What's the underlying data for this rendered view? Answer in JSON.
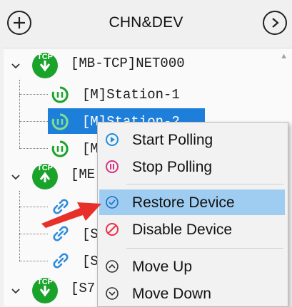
{
  "header": {
    "title": "CHN&DEV",
    "add_icon": "plus-circle-icon",
    "next_icon": "chevron-right-circle-icon"
  },
  "tree": {
    "nodes": [
      {
        "label": "[MB-TCP]NET000",
        "icon": "tcp-connection-icon"
      },
      {
        "label": "[M]Station-1",
        "icon": "polling-device-icon"
      },
      {
        "label": "[M]Station-2",
        "icon": "polling-device-icon",
        "selected": true
      },
      {
        "label": "[M",
        "icon": "polling-device-icon"
      },
      {
        "label": "[ME",
        "icon": "tcp-connection-icon"
      },
      {
        "label": "",
        "icon": "link-device-icon"
      },
      {
        "label": "[S",
        "icon": "link-device-icon"
      },
      {
        "label": "[S",
        "icon": "link-device-icon"
      },
      {
        "label": "[S7",
        "icon": "tcp-connection-icon"
      }
    ]
  },
  "context_menu": {
    "items": [
      {
        "label": "Start Polling",
        "icon": "play-circle-icon"
      },
      {
        "label": "Stop Polling",
        "icon": "pause-circle-icon"
      },
      {
        "label": "Restore Device",
        "icon": "check-circle-icon",
        "highlighted": true
      },
      {
        "label": "Disable Device",
        "icon": "disable-icon"
      },
      {
        "label": "Move Up",
        "icon": "up-circle-icon"
      },
      {
        "label": "Move Down",
        "icon": "down-circle-icon"
      }
    ]
  },
  "colors": {
    "tcp_green": "#1aa32a",
    "selection_blue": "#1e7fdb",
    "menu_highlight": "#9fcdf2",
    "start_polling_blue": "#1f8fe0",
    "stop_polling_pink": "#d63384",
    "disable_red": "#e8344a",
    "link_blue": "#2e8bdc",
    "arrow_red": "#e8302a"
  }
}
